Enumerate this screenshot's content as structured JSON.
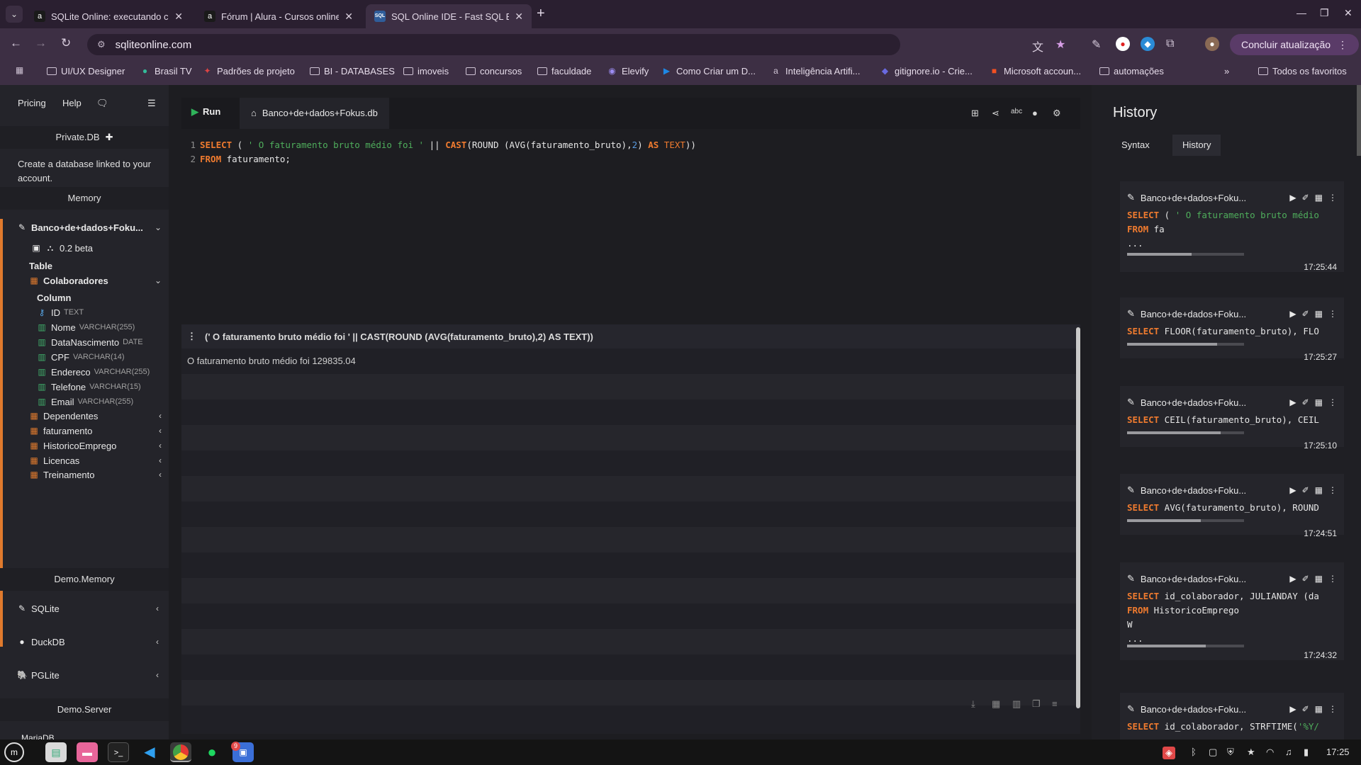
{
  "browser": {
    "tabs": [
      {
        "title": "SQLite Online: executando c",
        "favicon": "a"
      },
      {
        "title": "Fórum | Alura - Cursos online",
        "favicon": "a"
      },
      {
        "title": "SQL Online IDE - Fast SQL Ed",
        "favicon": "SQL"
      }
    ],
    "url": "sqliteonline.com",
    "update_button": "Concluir atualização",
    "bookmarks": [
      "UI/UX Designer",
      "Brasil TV",
      "Padrões de projeto",
      "BI - DATABASES",
      "imoveis",
      "concursos",
      "faculdade",
      "Elevify",
      "Como Criar um D...",
      "Inteligência Artifi...",
      "gitignore.io - Crie...",
      "Microsoft accoun...",
      "automações"
    ],
    "all_bookmarks": "Todos os favoritos",
    "more_bookmarks": "»"
  },
  "left": {
    "pricing": "Pricing",
    "help": "Help",
    "private_db": "Private.DB",
    "private_note": "Create a database linked to your account.",
    "memory": "Memory",
    "db_name": "Banco+de+dados+Foku...",
    "version": "0.2 beta",
    "table_header": "Table",
    "main_table": "Colaboradores",
    "column_header": "Column",
    "columns": [
      {
        "name": "ID",
        "type": "TEXT"
      },
      {
        "name": "Nome",
        "type": "VARCHAR(255)"
      },
      {
        "name": "DataNascimento",
        "type": "DATE"
      },
      {
        "name": "CPF",
        "type": "VARCHAR(14)"
      },
      {
        "name": "Endereco",
        "type": "VARCHAR(255)"
      },
      {
        "name": "Telefone",
        "type": "VARCHAR(15)"
      },
      {
        "name": "Email",
        "type": "VARCHAR(255)"
      }
    ],
    "other_tables": [
      "Dependentes",
      "faturamento",
      "HistoricoEmprego",
      "Licencas",
      "Treinamento"
    ],
    "demo_memory": "Demo.Memory",
    "engines": [
      "SQLite",
      "DuckDB",
      "PGLite"
    ],
    "demo_server": "Demo.Server",
    "mariadb": "MariaDB"
  },
  "editor": {
    "run_label": "Run",
    "file_tab": "Banco+de+dados+Fokus.db",
    "line_numbers": [
      "1",
      "2"
    ]
  },
  "results": {
    "column_header": "(' O faturamento bruto médio foi ' || CAST(ROUND (AVG(faturamento_bruto),2) AS TEXT))",
    "value": "O faturamento bruto médio foi 129835.04"
  },
  "history": {
    "title": "History",
    "tabs": [
      "Syntax",
      "History"
    ],
    "entries": [
      {
        "db": "Banco+de+dados+Foku...",
        "time": "17:25:44",
        "progress": 0.55
      },
      {
        "db": "Banco+de+dados+Foku...",
        "time": "17:25:27",
        "progress": 0.77
      },
      {
        "db": "Banco+de+dados+Foku...",
        "time": "17:25:10",
        "progress": 0.8
      },
      {
        "db": "Banco+de+dados+Foku...",
        "time": "17:24:51",
        "progress": 0.63
      },
      {
        "db": "Banco+de+dados+Foku...",
        "time": "17:24:32",
        "progress": 0.67
      },
      {
        "db": "Banco+de+dados+Foku..."
      }
    ]
  },
  "taskbar": {
    "clock": "17:25",
    "spotify_badge": "9"
  },
  "colors": {
    "accent": "#e07a2d",
    "keyword": "#f07b2f",
    "string": "#4fae5c",
    "number": "#5b9be0",
    "run": "#2fb35a"
  }
}
